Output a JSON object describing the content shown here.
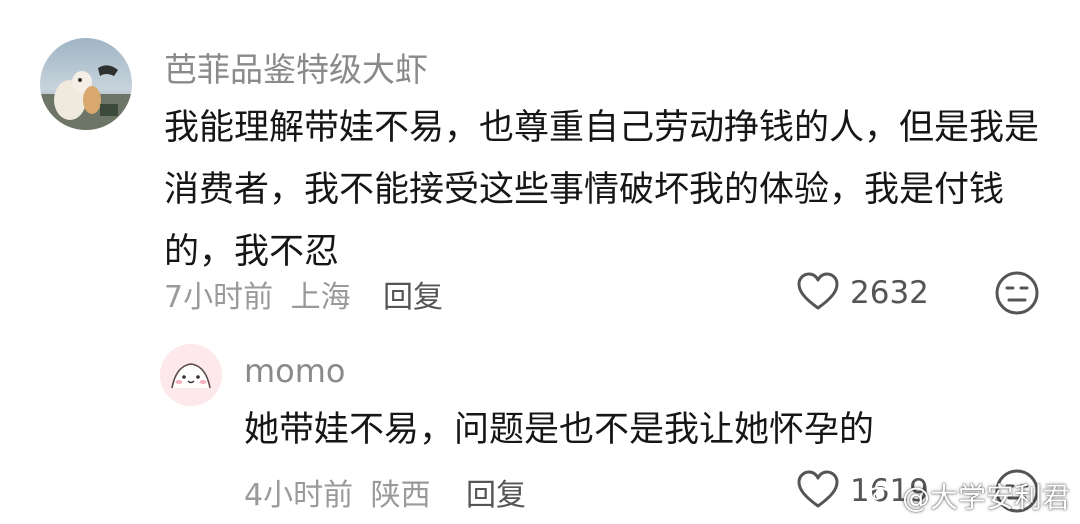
{
  "comment": {
    "username": "芭菲品鉴特级大虾",
    "text_lines": [
      "我能理解带娃不易，也尊重自己劳动挣钱的人，但是我是",
      "消费者，我不能接受这些事情破坏我的体验，我是付钱",
      "的，我不忍"
    ],
    "time": "7小时前",
    "location": "上海",
    "reply_label": "回复",
    "like_count": "2632"
  },
  "reply": {
    "username": "momo",
    "text": "她带娃不易，问题是也不是我让她怀孕的",
    "time": "4小时前",
    "location": "陕西",
    "reply_label": "回复",
    "like_count": "1619"
  },
  "watermark": {
    "text": "@大学安利君"
  },
  "icons": {
    "like": "heart-outline-icon",
    "dislike": "meh-face-icon",
    "watermark_logo": "weibo-logo-icon"
  },
  "colors": {
    "username": "#8a8a8a",
    "body": "#161616",
    "meta": "#9a9a9a",
    "action": "#555555"
  }
}
